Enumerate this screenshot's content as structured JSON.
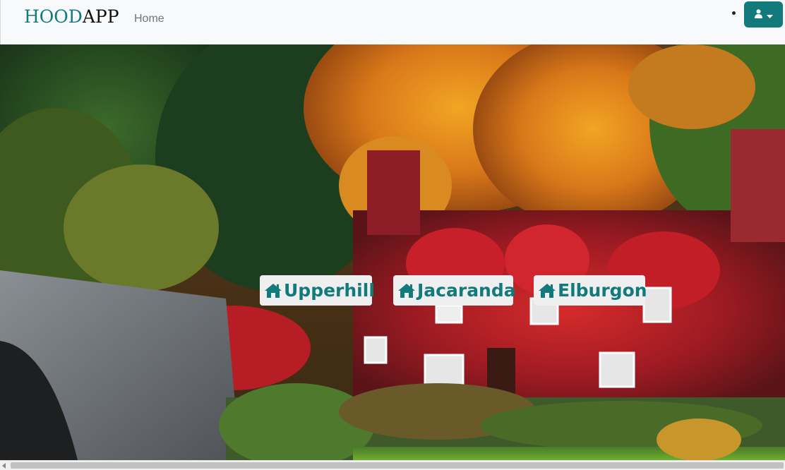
{
  "navbar": {
    "brand_part1": "HOOD",
    "brand_part2": "APP",
    "home_label": "Home",
    "user_menu_icon": "user-icon",
    "user_menu_caret": "caret-down-icon"
  },
  "hero": {
    "background": "autumn ivy-covered cottage photo",
    "neighbourhoods": [
      {
        "label": "Upperhill",
        "icon": "home-icon"
      },
      {
        "label": "Jacaranda",
        "icon": "home-icon"
      },
      {
        "label": "Elburgon",
        "icon": "home-icon"
      }
    ]
  },
  "colors": {
    "accent": "#127a7b",
    "navbar_bg": "#f8f9fa",
    "button_bg": "#efefef"
  }
}
